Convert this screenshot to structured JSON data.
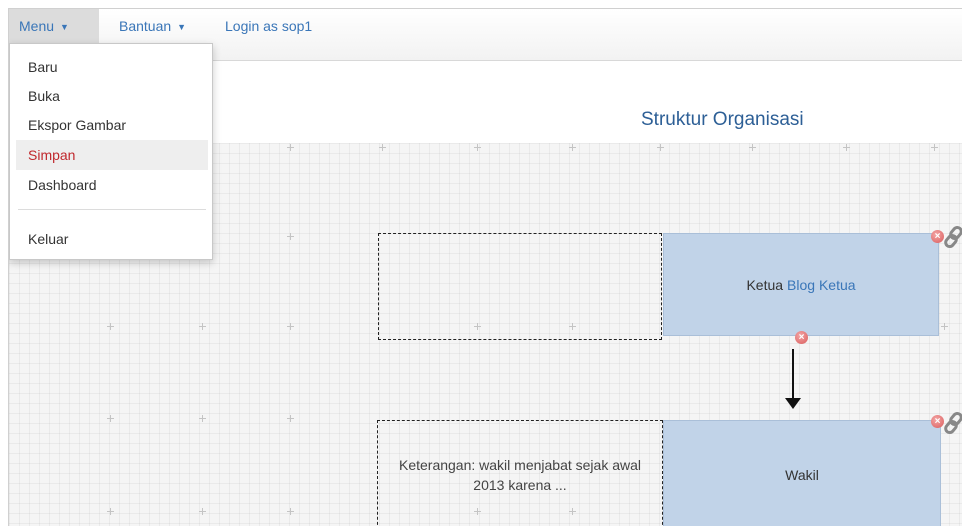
{
  "navbar": {
    "menu_label": "Menu",
    "bantuan_label": "Bantuan",
    "login_label": "Login as sop1"
  },
  "dropdown": {
    "items": [
      {
        "label": "Baru"
      },
      {
        "label": "Buka"
      },
      {
        "label": "Ekspor Gambar"
      },
      {
        "label": "Simpan",
        "active": true
      },
      {
        "label": "Dashboard"
      },
      {
        "label": "Keluar"
      }
    ]
  },
  "page": {
    "title": "Struktur Organisasi"
  },
  "org_chart": {
    "note_box_text": "",
    "ketua_label": "Ketua",
    "ketua_name": "Blog Ketua",
    "keterangan_text": "Keterangan: wakil menjabat sejak awal 2013 karena ...",
    "wakil_label": "Wakil"
  },
  "colors": {
    "accent": "#3a76b8",
    "title": "#2d5f96",
    "node_fill": "#c1d3e8",
    "active_item": "#c0282d",
    "delete": "#d95c5c"
  },
  "icons": {
    "delete": "close-circle-icon",
    "link": "chain-link-icon",
    "caret": "caret-down-icon"
  }
}
